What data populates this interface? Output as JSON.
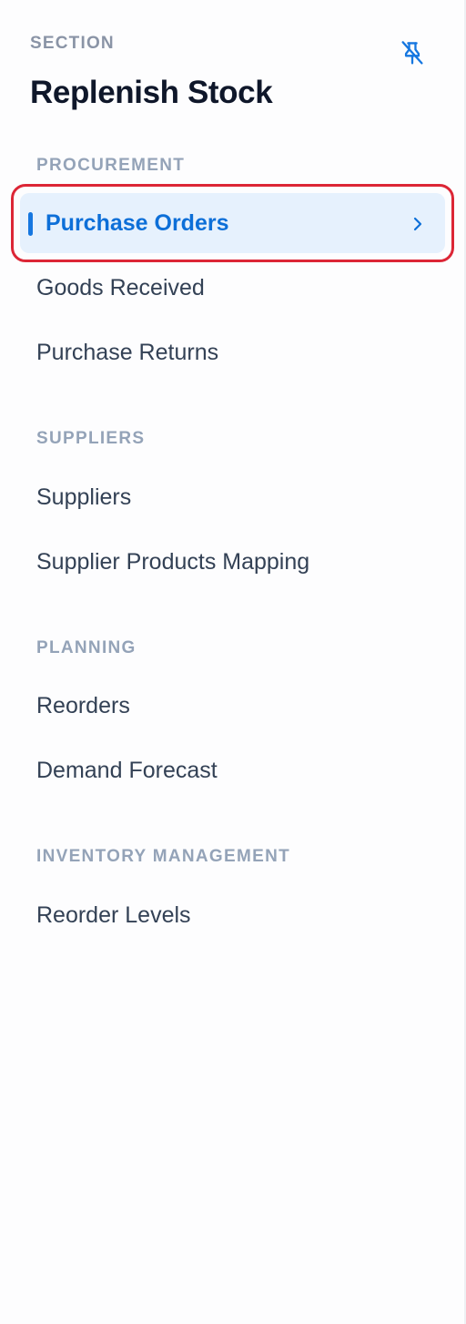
{
  "header": {
    "eyebrow": "SECTION",
    "title": "Replenish Stock"
  },
  "groups": [
    {
      "label": "PROCUREMENT",
      "items": [
        "Purchase Orders",
        "Goods Received",
        "Purchase Returns"
      ]
    },
    {
      "label": "SUPPLIERS",
      "items": [
        "Suppliers",
        "Supplier Products Mapping"
      ]
    },
    {
      "label": "PLANNING",
      "items": [
        "Reorders",
        "Demand Forecast"
      ]
    },
    {
      "label": "INVENTORY MANAGEMENT",
      "items": [
        "Reorder Levels"
      ]
    }
  ],
  "active_item": "Purchase Orders",
  "icons": {
    "pin": "pin-off-icon",
    "chevron": "chevron-right-icon"
  },
  "colors": {
    "accent": "#1677e0",
    "active_bg": "#e6f1fd",
    "highlight_border": "#dc2636"
  }
}
